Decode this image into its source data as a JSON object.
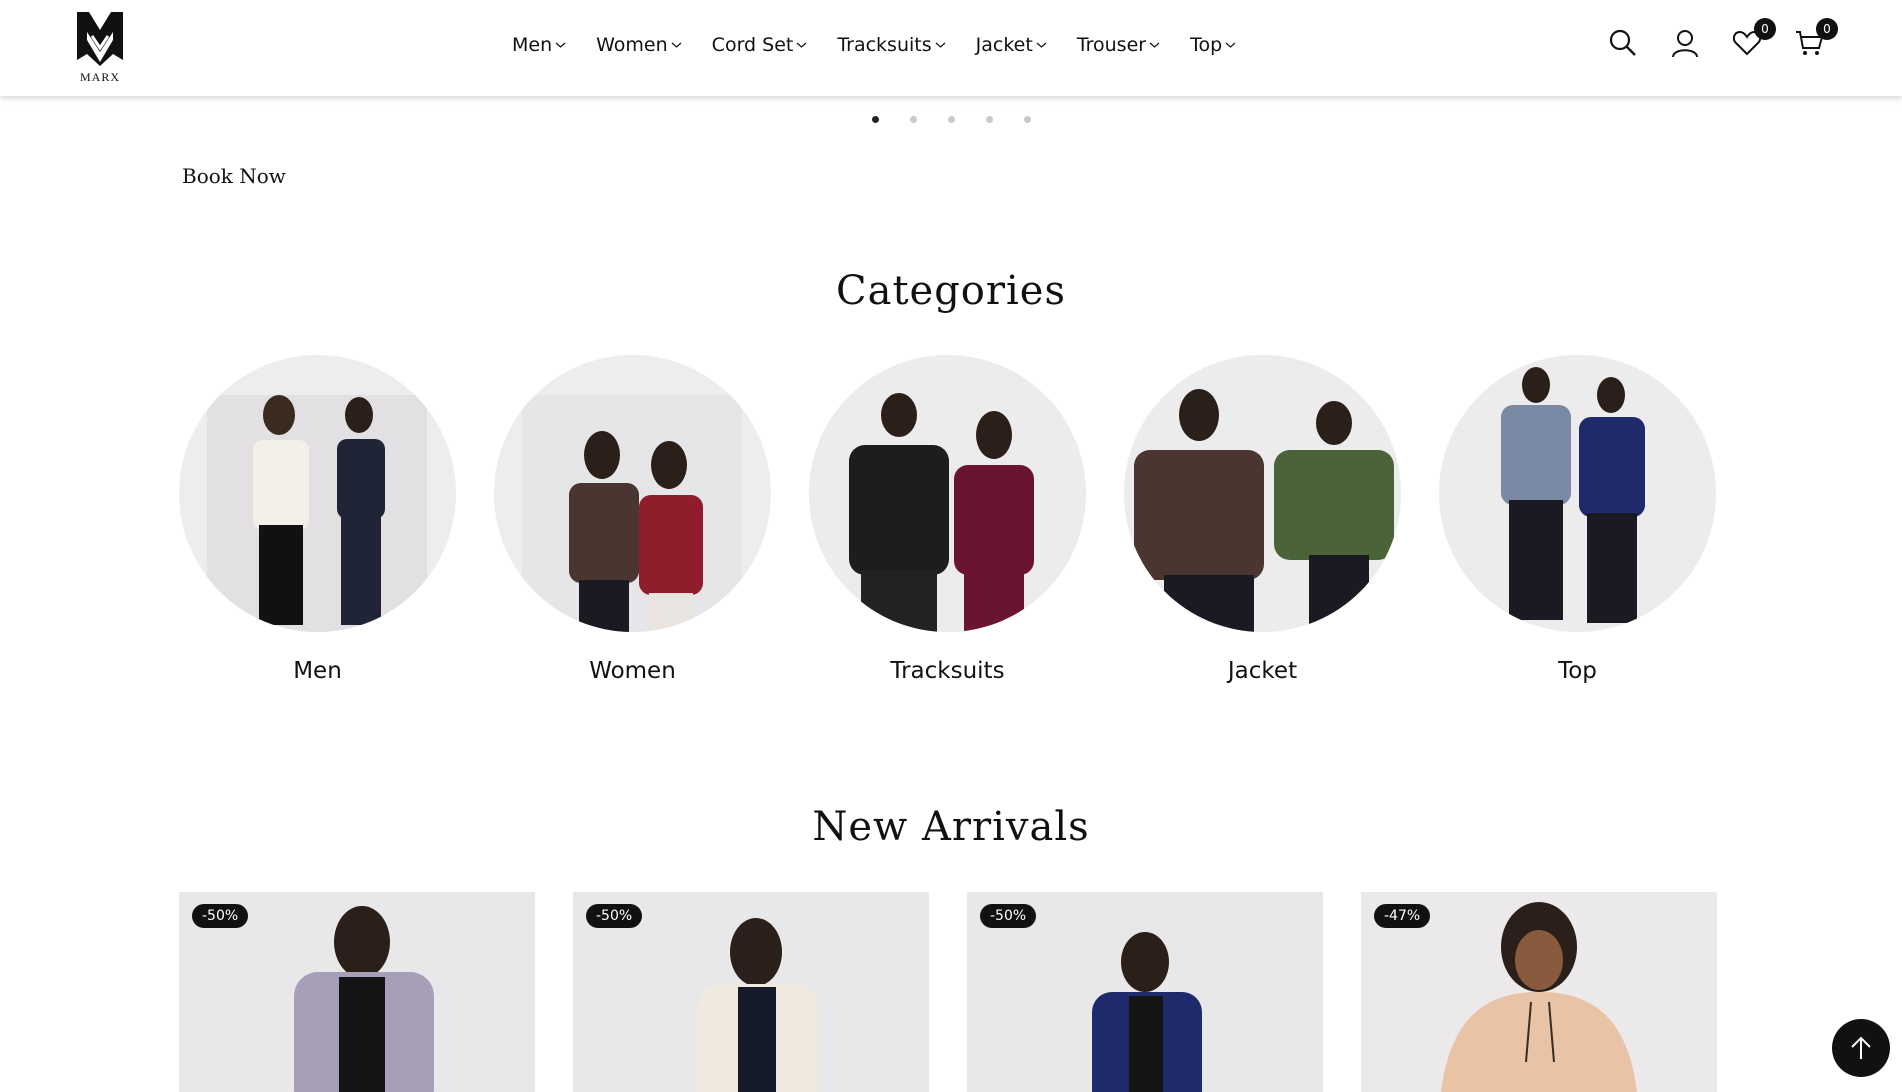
{
  "brand": {
    "name": "MARX"
  },
  "nav": {
    "items": [
      {
        "label": "Men"
      },
      {
        "label": "Women"
      },
      {
        "label": "Cord Set"
      },
      {
        "label": "Tracksuits"
      },
      {
        "label": "Jacket"
      },
      {
        "label": "Trouser"
      },
      {
        "label": "Top"
      }
    ]
  },
  "header_icons": {
    "wishlist_count": "0",
    "cart_count": "0"
  },
  "carousel": {
    "dot_count": 5,
    "active_index": 0
  },
  "hero": {
    "book_now": "Book Now"
  },
  "categories": {
    "title": "Categories",
    "items": [
      {
        "label": "Men"
      },
      {
        "label": "Women"
      },
      {
        "label": "Tracksuits"
      },
      {
        "label": "Jacket"
      },
      {
        "label": "Top"
      }
    ]
  },
  "new_arrivals": {
    "title": "New Arrivals",
    "products": [
      {
        "discount": "-50%"
      },
      {
        "discount": "-50%"
      },
      {
        "discount": "-50%"
      },
      {
        "discount": "-47%"
      }
    ]
  },
  "colors": {
    "accent": "#111111",
    "tile_bg": "#ededed"
  }
}
